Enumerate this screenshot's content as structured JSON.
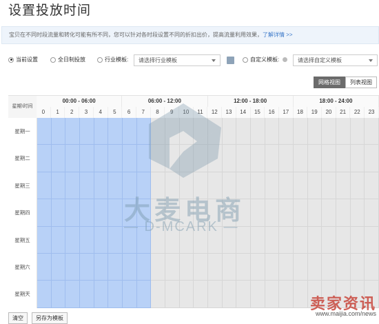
{
  "page": {
    "title": "设置投放时间"
  },
  "info": {
    "text": "宝贝在不同时段流量和转化可能有所不同，您可以针对各时段设置不同的折扣出价，提高流量利用效果，",
    "link": "了解详情 >>"
  },
  "options": {
    "current": "当前设置",
    "allday": "全日制投放",
    "industry": "行业模板:",
    "industry_select": "请选择行业模板",
    "custom": "自定义模板:",
    "custom_select": "请选择自定义模板"
  },
  "views": {
    "grid": "网格视图",
    "list": "列表视图"
  },
  "grid": {
    "corner_label": "星期\\时间",
    "groups": [
      "00:00 - 06:00",
      "06:00 - 12:00",
      "12:00 - 18:00",
      "18:00 - 24:00"
    ],
    "hours": [
      "0",
      "1",
      "2",
      "3",
      "4",
      "5",
      "6",
      "7",
      "8",
      "9",
      "10",
      "11",
      "12",
      "13",
      "14",
      "15",
      "16",
      "17",
      "18",
      "19",
      "20",
      "21",
      "22",
      "23"
    ],
    "days": [
      "星期一",
      "星期二",
      "星期三",
      "星期四",
      "星期五",
      "星期六",
      "星期天"
    ],
    "selected_hours": [
      0,
      1,
      2,
      3,
      4,
      5,
      6,
      7
    ]
  },
  "buttons": {
    "clear": "清空",
    "save_as": "另存为模板"
  },
  "watermark": {
    "cn": "大麦电商",
    "en": "— D-MCARK —",
    "corner": "卖家资讯",
    "corner_url": "www.maijia.com/news"
  },
  "colors": {
    "selected": "#b8d1f7",
    "unselected": "#e7e7e7",
    "active_view": "#6b6b6b"
  }
}
